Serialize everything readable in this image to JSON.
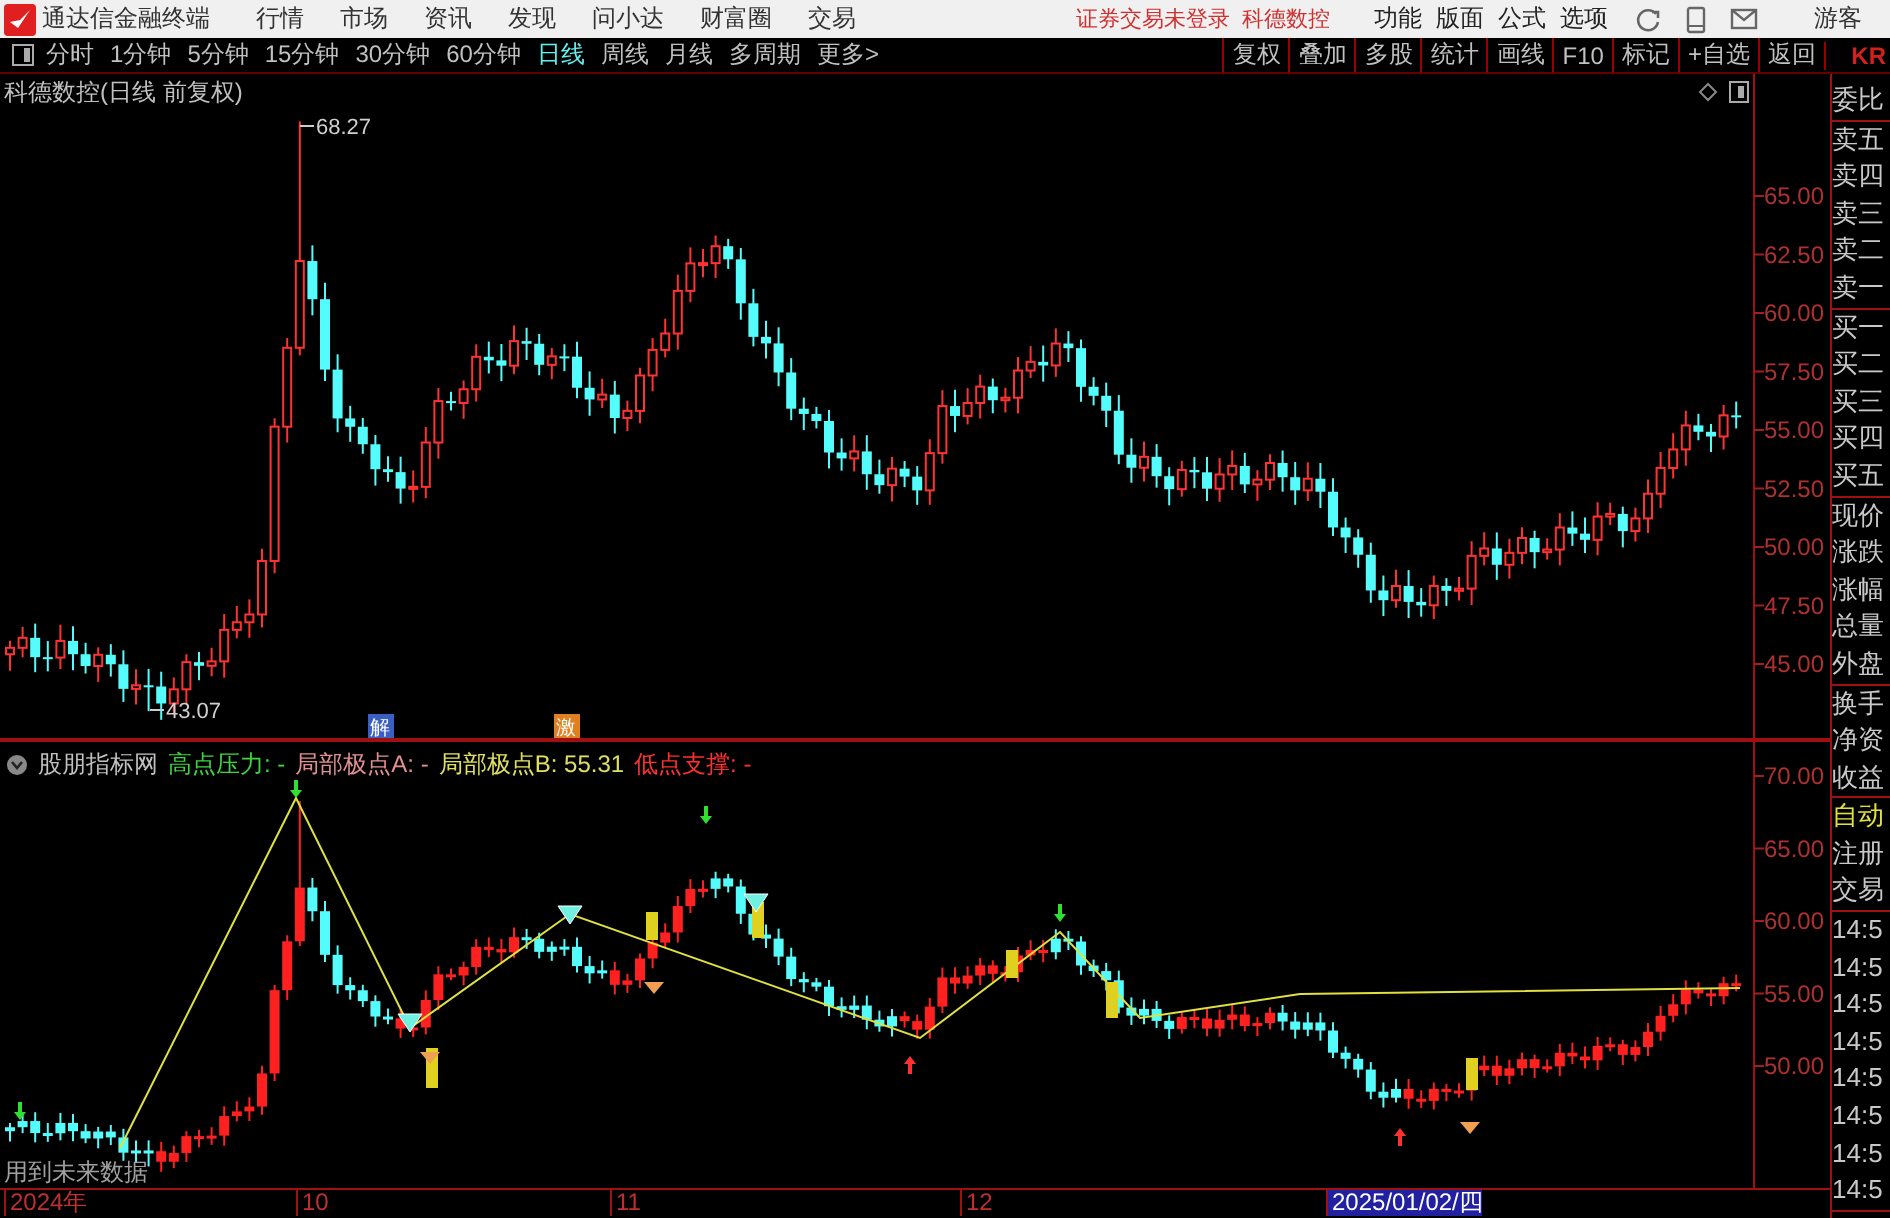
{
  "app": {
    "title": "通达信金融终端"
  },
  "menu": [
    "行情",
    "市场",
    "资讯",
    "发现",
    "问小达",
    "财富圈",
    "交易"
  ],
  "notice": "证券交易未登录",
  "stock_name": "科德数控",
  "tools": [
    "功能",
    "版面",
    "公式",
    "选项"
  ],
  "user": "游客",
  "periods": [
    {
      "label": "分时",
      "selected": false
    },
    {
      "label": "1分钟",
      "selected": false
    },
    {
      "label": "5分钟",
      "selected": false
    },
    {
      "label": "15分钟",
      "selected": false
    },
    {
      "label": "30分钟",
      "selected": false
    },
    {
      "label": "60分钟",
      "selected": false
    },
    {
      "label": "日线",
      "selected": true
    },
    {
      "label": "周线",
      "selected": false
    },
    {
      "label": "月线",
      "selected": false
    },
    {
      "label": "多周期",
      "selected": false
    },
    {
      "label": "更多>",
      "selected": false
    }
  ],
  "actions": [
    "复权",
    "叠加",
    "多股",
    "统计",
    "画线",
    "F10",
    "标记",
    "+自选",
    "返回"
  ],
  "corner_label": "KR",
  "main_chart": {
    "title": "科德数控(日线 前复权)",
    "high_label": "68.27",
    "low_label": "43.07",
    "events": [
      {
        "label": "解",
        "color": "#3a5fc0"
      },
      {
        "label": "激",
        "color": "#e08020"
      }
    ],
    "yticks": [
      "65.00",
      "62.50",
      "60.00",
      "57.50",
      "55.00",
      "52.50",
      "50.00",
      "47.50",
      "45.00"
    ]
  },
  "indicator": {
    "header": [
      {
        "label": "股朋指标网",
        "color": "#c0c0c0"
      },
      {
        "label": "高点压力: -",
        "color": "#3fd43f"
      },
      {
        "label": "局部极点A: -",
        "color": "#e09090"
      },
      {
        "label": "局部极点B: 55.31",
        "color": "#e0e060"
      },
      {
        "label": "低点支撑: -",
        "color": "#ff3030"
      }
    ],
    "yticks": [
      "70.00",
      "65.00",
      "60.00",
      "55.00",
      "50.00"
    ],
    "footnote": "用到未来数据"
  },
  "time_axis": [
    {
      "label": "2024年",
      "selected": false
    },
    {
      "label": "10",
      "selected": false
    },
    {
      "label": "11",
      "selected": false
    },
    {
      "label": "12",
      "selected": false
    },
    {
      "label": "2025/01/02/四",
      "selected": true
    }
  ],
  "quote_panel": [
    {
      "items": [
        {
          "label": "委比",
          "selected": false
        }
      ]
    },
    {
      "items": [
        {
          "label": "卖五",
          "selected": false
        },
        {
          "label": "卖四",
          "selected": false
        },
        {
          "label": "卖三",
          "selected": false
        },
        {
          "label": "卖二",
          "selected": false
        },
        {
          "label": "卖一",
          "selected": false
        }
      ]
    },
    {
      "items": [
        {
          "label": "买一",
          "selected": false
        },
        {
          "label": "买二",
          "selected": false
        },
        {
          "label": "买三",
          "selected": false
        },
        {
          "label": "买四",
          "selected": false
        },
        {
          "label": "买五",
          "selected": false
        }
      ]
    },
    {
      "items": [
        {
          "label": "现价",
          "selected": false
        },
        {
          "label": "涨跌",
          "selected": false
        },
        {
          "label": "涨幅",
          "selected": false
        },
        {
          "label": "总量",
          "selected": false
        },
        {
          "label": "外盘",
          "selected": false
        }
      ]
    },
    {
      "items": [
        {
          "label": "换手",
          "selected": false
        },
        {
          "label": "净资",
          "selected": false
        },
        {
          "label": "收益",
          "selected": false
        }
      ]
    },
    {
      "items": [
        {
          "label": "自动",
          "selected": true
        },
        {
          "label": "注册",
          "selected": false
        },
        {
          "label": "交易",
          "selected": false
        }
      ]
    },
    {
      "items": [
        {
          "label": "14:5",
          "selected": false
        },
        {
          "label": "14:5",
          "selected": false
        },
        {
          "label": "14:5",
          "selected": false
        },
        {
          "label": "14:5",
          "selected": false
        },
        {
          "label": "14:5",
          "selected": false
        },
        {
          "label": "14:5",
          "selected": false
        },
        {
          "label": "14:5",
          "selected": false
        },
        {
          "label": "14:5",
          "selected": false
        }
      ]
    }
  ]
}
